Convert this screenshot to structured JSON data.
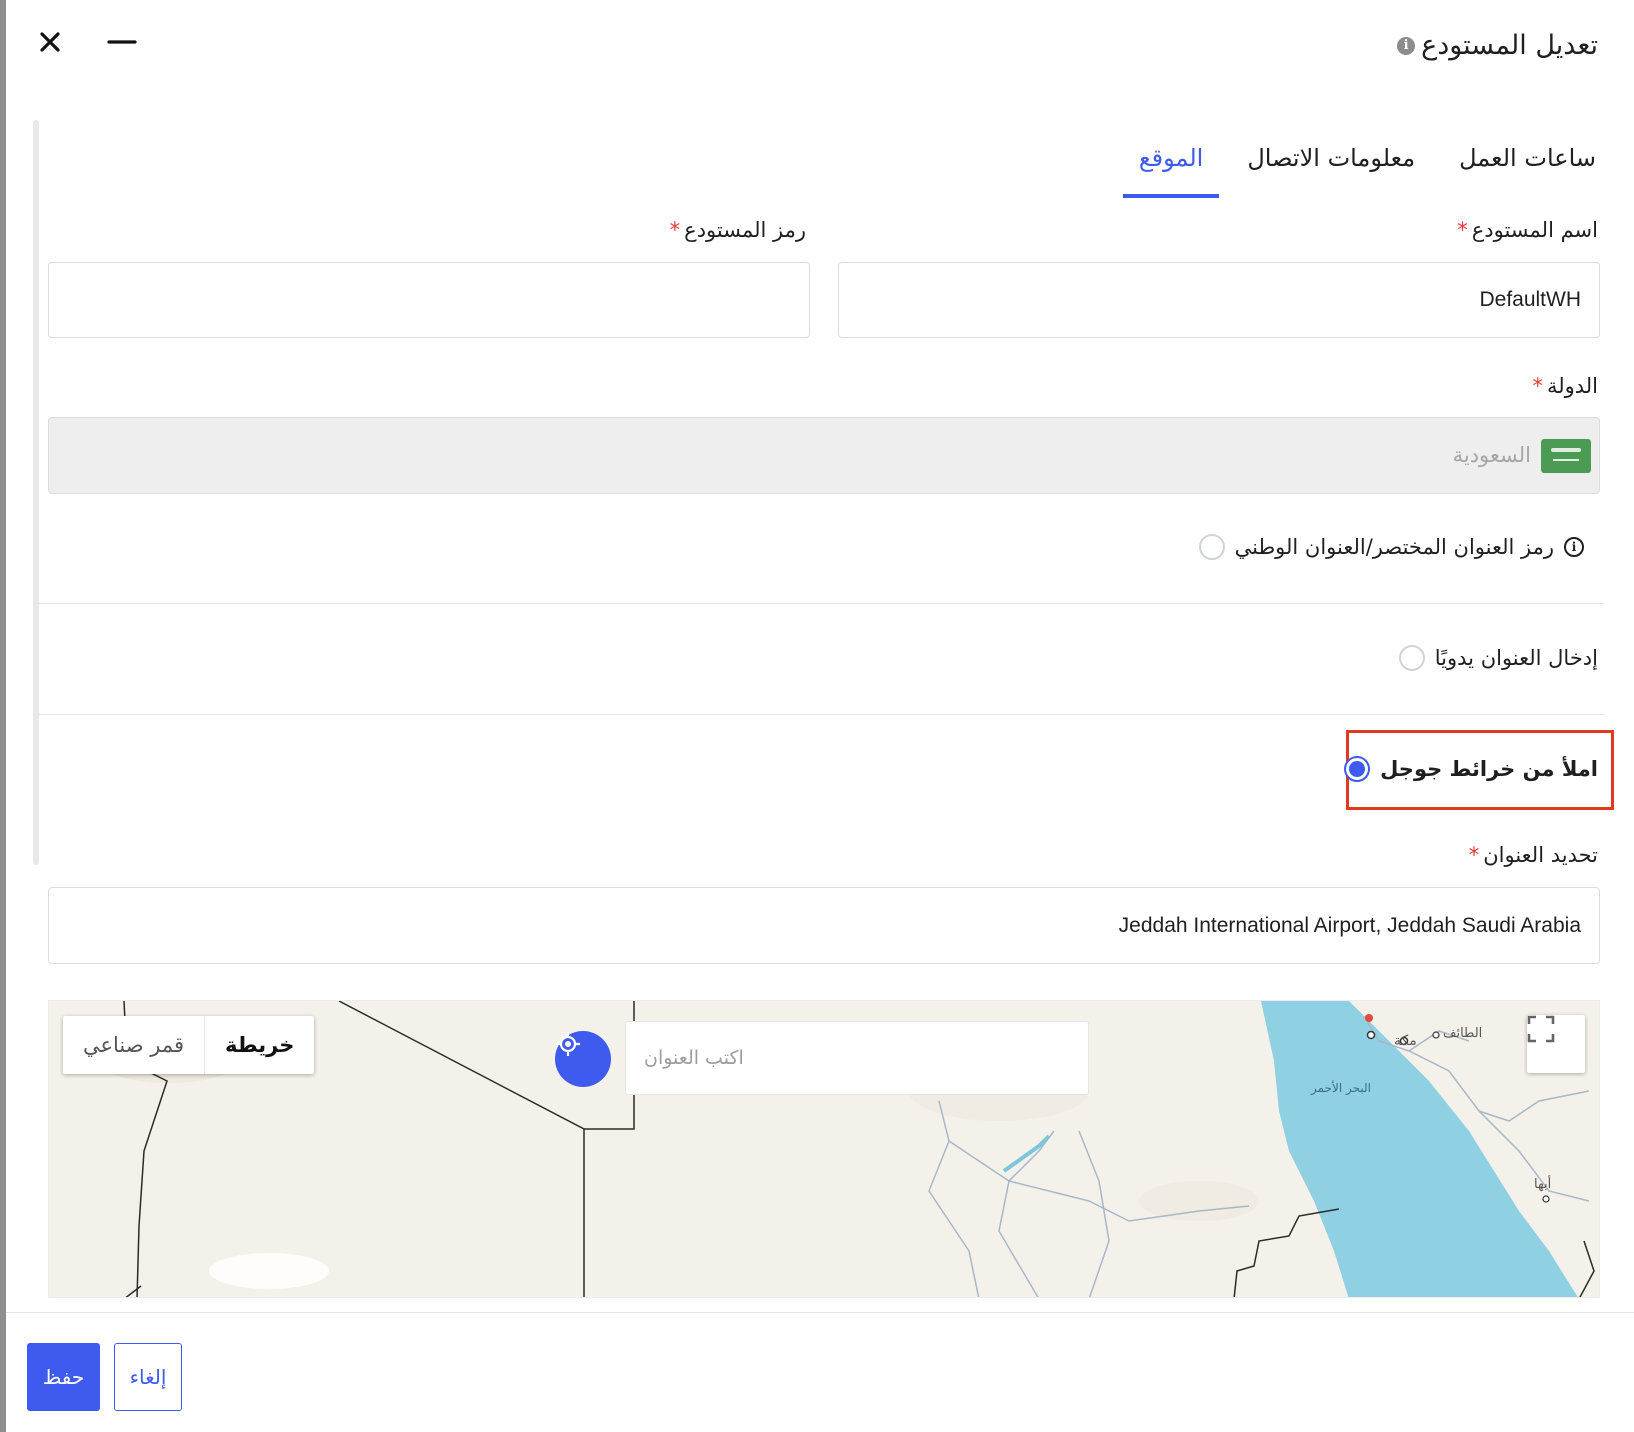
{
  "header": {
    "title": "تعديل المستودع"
  },
  "tabs": [
    {
      "label": "الموقع",
      "active": true
    },
    {
      "label": "معلومات الاتصال",
      "active": false
    },
    {
      "label": "ساعات العمل",
      "active": false
    }
  ],
  "form": {
    "warehouse_name": {
      "label": "اسم المستودع",
      "required_mark": "*",
      "value": "DefaultWH"
    },
    "warehouse_code": {
      "label": "رمز المستودع",
      "required_mark": "*",
      "value": ""
    },
    "country": {
      "label": "الدولة",
      "required_mark": "*",
      "value": "السعودية"
    },
    "address_options": [
      {
        "label": "رمز العنوان المختصر/العنوان الوطني",
        "checked": false
      },
      {
        "label": "إدخال العنوان يدويًا",
        "checked": false
      },
      {
        "label": "املأ من خرائط جوجل",
        "checked": true
      }
    ],
    "address_select": {
      "label": "تحديد العنوان",
      "required_mark": "*",
      "value": "Jeddah International Airport, Jeddah Saudi Arabia"
    }
  },
  "map": {
    "type_buttons": [
      {
        "label": "خريطة",
        "active": true
      },
      {
        "label": "قمر صناعي",
        "active": false
      }
    ],
    "search_placeholder": "اكتب العنوان",
    "labels": {
      "taif": "الطائف",
      "makkah": "مكة",
      "red_sea": "البحر الأحمر",
      "abha": "أبها"
    },
    "colors": {
      "water": "#8fd0e3",
      "land": "#f4f1ea",
      "accent": "#3f5bef"
    }
  },
  "footer": {
    "save_label": "حفظ",
    "cancel_label": "إلغاء"
  },
  "colors": {
    "accent": "#3f5bef",
    "required": "#e53935",
    "highlight": "#e03a22"
  }
}
